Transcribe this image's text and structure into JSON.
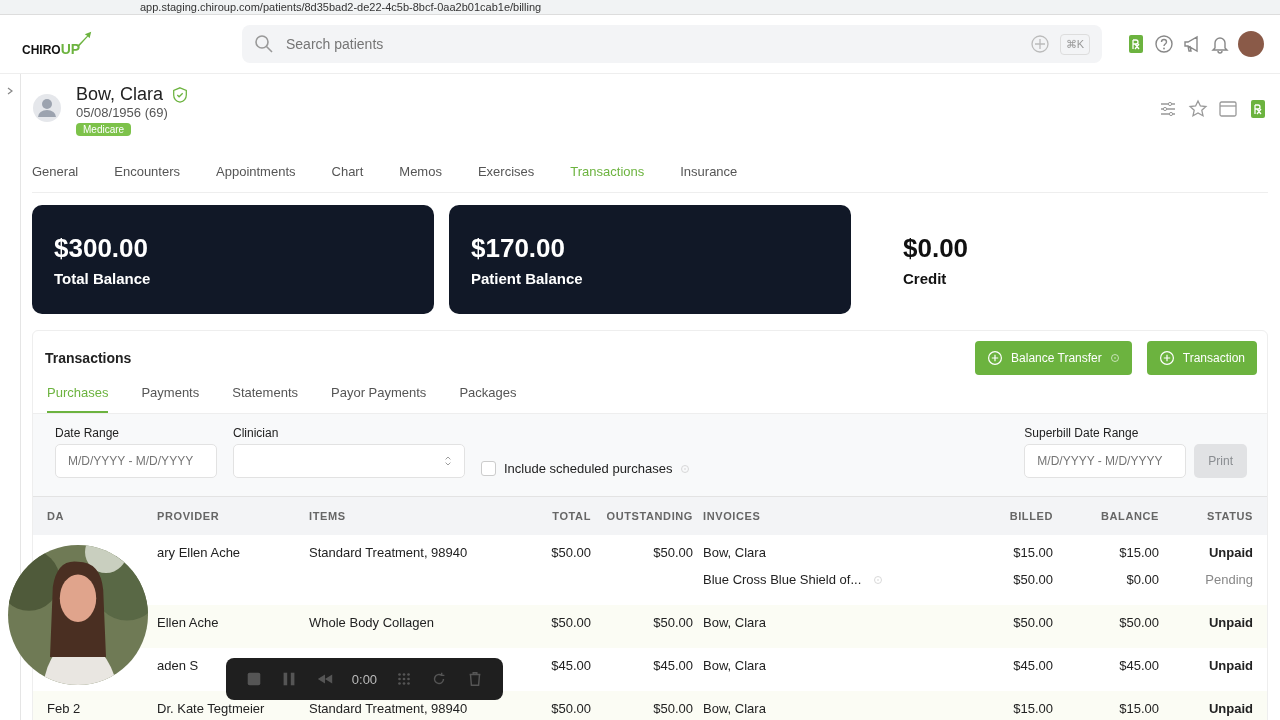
{
  "browser": {
    "url": "app.staging.chiroup.com/patients/8d35bad2-de22-4c5b-8bcf-0aa2b01cab1e/billing"
  },
  "app_header": {
    "logo": [
      "CHIRO",
      "UP"
    ],
    "search": {
      "placeholder": "Search patients",
      "shortcut": "⌘K"
    }
  },
  "patient": {
    "name": "Bow, Clara",
    "dob": "05/08/1956 (69)",
    "badge": "Medicare",
    "verified": true
  },
  "tabs": [
    {
      "label": "General",
      "selected": false
    },
    {
      "label": "Encounters",
      "selected": false
    },
    {
      "label": "Appointments",
      "selected": false
    },
    {
      "label": "Chart",
      "selected": false
    },
    {
      "label": "Memos",
      "selected": false
    },
    {
      "label": "Exercises",
      "selected": false
    },
    {
      "label": "Transactions",
      "selected": true
    },
    {
      "label": "Insurance",
      "selected": false
    }
  ],
  "balances": [
    {
      "amount": "$300.00",
      "label": "Total Balance",
      "kind": "dark"
    },
    {
      "amount": "$170.00",
      "label": "Patient Balance",
      "kind": "dark"
    },
    {
      "amount": "$0.00",
      "label": "Credit",
      "kind": "plain"
    }
  ],
  "transactions": {
    "title": "Transactions",
    "buttons": [
      {
        "label": "Balance Transfer",
        "help": true
      },
      {
        "label": "Transaction",
        "help": false
      }
    ],
    "subtabs": [
      {
        "label": "Purchases",
        "selected": true
      },
      {
        "label": "Payments",
        "selected": false
      },
      {
        "label": "Statements",
        "selected": false
      },
      {
        "label": "Payor Payments",
        "selected": false
      },
      {
        "label": "Packages",
        "selected": false
      }
    ],
    "filters": {
      "date_range": {
        "label": "Date Range",
        "placeholder": "M/D/YYYY - M/D/YYYY"
      },
      "clinician": {
        "label": "Clinician"
      },
      "include_scheduled": {
        "label": "Include scheduled purchases",
        "checked": false
      },
      "superbill": {
        "label": "Superbill Date Range",
        "placeholder": "M/D/YYYY - M/D/YYYY"
      },
      "print": {
        "label": "Print",
        "disabled": true
      }
    },
    "columns": [
      "DA",
      "PROVIDER",
      "ITEMS",
      "TOTAL",
      "OUTSTANDING",
      "INVOICES",
      "BILLED",
      "BALANCE",
      "STATUS"
    ],
    "rows": [
      {
        "provider": "ary Ellen Ache",
        "items": "Standard Treatment, 98940",
        "total": "$50.00",
        "outstanding": "$50.00",
        "invoices": [
          {
            "payer": "Bow, Clara",
            "billed": "$15.00",
            "balance": "$15.00",
            "status": "Unpaid",
            "kind": "due",
            "info": false
          },
          {
            "payer": "Blue Cross Blue Shield of...",
            "billed": "$50.00",
            "balance": "$0.00",
            "status": "Pending",
            "kind": "pending",
            "info": true
          }
        ]
      },
      {
        "provider": "Ellen Ache",
        "items": "Whole Body Collagen",
        "total": "$50.00",
        "outstanding": "$50.00",
        "invoices": [
          {
            "payer": "Bow, Clara",
            "billed": "$50.00",
            "balance": "$50.00",
            "status": "Unpaid",
            "kind": "due",
            "info": false
          }
        ]
      },
      {
        "provider": "aden S",
        "total": "$45.00",
        "outstanding": "$45.00",
        "invoices": [
          {
            "payer": "Bow, Clara",
            "billed": "$45.00",
            "balance": "$45.00",
            "status": "Unpaid",
            "kind": "due",
            "info": false
          }
        ]
      },
      {
        "date": "Feb 2",
        "provider": "Dr. Kate Tegtmeier",
        "items": "Standard Treatment, 98940",
        "total": "$50.00",
        "outstanding": "$50.00",
        "invoices": [
          {
            "payer": "Bow, Clara",
            "billed": "$15.00",
            "balance": "$15.00",
            "status": "Unpaid",
            "kind": "due",
            "info": false
          }
        ]
      }
    ]
  },
  "recorder": {
    "time": "0:00"
  }
}
